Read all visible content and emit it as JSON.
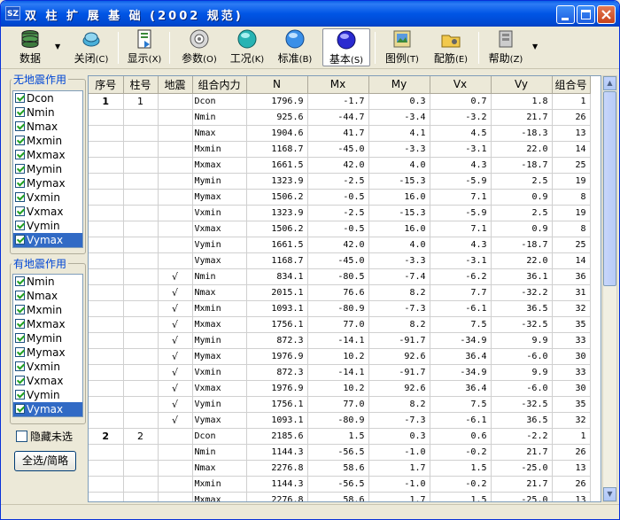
{
  "window": {
    "title": "双 柱 扩 展 基 础 (2002 规范)",
    "icon": "SZ"
  },
  "toolbar": [
    {
      "label": "数据",
      "key": "(D)",
      "icon": "database-icon",
      "dropdown": true
    },
    {
      "label": "关闭",
      "key": "(C)",
      "icon": "close-disk-icon"
    },
    {
      "label": "显示",
      "key": "(X)",
      "icon": "display-icon"
    },
    {
      "label": "参数",
      "key": "(O)",
      "icon": "params-icon"
    },
    {
      "label": "工况",
      "key": "(K)",
      "icon": "case-icon"
    },
    {
      "label": "标准",
      "key": "(B)",
      "icon": "standard-icon"
    },
    {
      "label": "基本",
      "key": "(S)",
      "icon": "basic-icon",
      "active": true
    },
    {
      "label": "图例",
      "key": "(T)",
      "icon": "legend-icon"
    },
    {
      "label": "配筋",
      "key": "(E)",
      "icon": "rebar-icon"
    },
    {
      "label": "帮助",
      "key": "(Z)",
      "icon": "help-icon",
      "dropdown": true
    }
  ],
  "left": {
    "group1": {
      "label": "无地震作用",
      "items": [
        "Dcon",
        "Nmin",
        "Nmax",
        "Mxmin",
        "Mxmax",
        "Mymin",
        "Mymax",
        "Vxmin",
        "Vxmax",
        "Vymin",
        "Vymax"
      ],
      "selected": "Vymax"
    },
    "group2": {
      "label": "有地震作用",
      "items": [
        "Nmin",
        "Nmax",
        "Mxmin",
        "Mxmax",
        "Mymin",
        "Mymax",
        "Vxmin",
        "Vxmax",
        "Vymin",
        "Vymax"
      ],
      "selected": "Vymax"
    },
    "hide_label": "隐藏未选",
    "select_all": "全选/简略"
  },
  "table": {
    "columns": [
      "序号",
      "柱号",
      "地震",
      "组合内力",
      "N",
      "Mx",
      "My",
      "Vx",
      "Vy",
      "组合号"
    ],
    "rows": [
      [
        "1",
        "1",
        "",
        "Dcon",
        "1796.9",
        "-1.7",
        "0.3",
        "0.7",
        "1.8",
        "1"
      ],
      [
        "",
        "",
        "",
        "Nmin",
        "925.6",
        "-44.7",
        "-3.4",
        "-3.2",
        "21.7",
        "26"
      ],
      [
        "",
        "",
        "",
        "Nmax",
        "1904.6",
        "41.7",
        "4.1",
        "4.5",
        "-18.3",
        "13"
      ],
      [
        "",
        "",
        "",
        "Mxmin",
        "1168.7",
        "-45.0",
        "-3.3",
        "-3.1",
        "22.0",
        "14"
      ],
      [
        "",
        "",
        "",
        "Mxmax",
        "1661.5",
        "42.0",
        "4.0",
        "4.3",
        "-18.7",
        "25"
      ],
      [
        "",
        "",
        "",
        "Mymin",
        "1323.9",
        "-2.5",
        "-15.3",
        "-5.9",
        "2.5",
        "19"
      ],
      [
        "",
        "",
        "",
        "Mymax",
        "1506.2",
        "-0.5",
        "16.0",
        "7.1",
        "0.9",
        "8"
      ],
      [
        "",
        "",
        "",
        "Vxmin",
        "1323.9",
        "-2.5",
        "-15.3",
        "-5.9",
        "2.5",
        "19"
      ],
      [
        "",
        "",
        "",
        "Vxmax",
        "1506.2",
        "-0.5",
        "16.0",
        "7.1",
        "0.9",
        "8"
      ],
      [
        "",
        "",
        "",
        "Vymin",
        "1661.5",
        "42.0",
        "4.0",
        "4.3",
        "-18.7",
        "25"
      ],
      [
        "",
        "",
        "",
        "Vymax",
        "1168.7",
        "-45.0",
        "-3.3",
        "-3.1",
        "22.0",
        "14"
      ],
      [
        "",
        "",
        "√",
        "Nmin",
        "834.1",
        "-80.5",
        "-7.4",
        "-6.2",
        "36.1",
        "36"
      ],
      [
        "",
        "",
        "√",
        "Nmax",
        "2015.1",
        "76.6",
        "8.2",
        "7.7",
        "-32.2",
        "31"
      ],
      [
        "",
        "",
        "√",
        "Mxmin",
        "1093.1",
        "-80.9",
        "-7.3",
        "-6.1",
        "36.5",
        "32"
      ],
      [
        "",
        "",
        "√",
        "Mxmax",
        "1756.1",
        "77.0",
        "8.2",
        "7.5",
        "-32.5",
        "35"
      ],
      [
        "",
        "",
        "√",
        "Mymin",
        "872.3",
        "-14.1",
        "-91.7",
        "-34.9",
        "9.9",
        "33"
      ],
      [
        "",
        "",
        "√",
        "Mymax",
        "1976.9",
        "10.2",
        "92.6",
        "36.4",
        "-6.0",
        "30"
      ],
      [
        "",
        "",
        "√",
        "Vxmin",
        "872.3",
        "-14.1",
        "-91.7",
        "-34.9",
        "9.9",
        "33"
      ],
      [
        "",
        "",
        "√",
        "Vxmax",
        "1976.9",
        "10.2",
        "92.6",
        "36.4",
        "-6.0",
        "30"
      ],
      [
        "",
        "",
        "√",
        "Vymin",
        "1756.1",
        "77.0",
        "8.2",
        "7.5",
        "-32.5",
        "35"
      ],
      [
        "",
        "",
        "√",
        "Vymax",
        "1093.1",
        "-80.9",
        "-7.3",
        "-6.1",
        "36.5",
        "32"
      ],
      [
        "2",
        "2",
        "",
        "Dcon",
        "2185.6",
        "1.5",
        "0.3",
        "0.6",
        "-2.2",
        "1"
      ],
      [
        "",
        "",
        "",
        "Nmin",
        "1144.3",
        "-56.5",
        "-1.0",
        "-0.2",
        "21.7",
        "26"
      ],
      [
        "",
        "",
        "",
        "Nmax",
        "2276.8",
        "58.6",
        "1.7",
        "1.5",
        "-25.0",
        "13"
      ],
      [
        "",
        "",
        "",
        "Mxmin",
        "1144.3",
        "-56.5",
        "-1.0",
        "-0.2",
        "21.7",
        "26"
      ],
      [
        "",
        "",
        "",
        "Mxmax",
        "2276.8",
        "58.6",
        "1.7",
        "1.5",
        "-25.0",
        "13"
      ]
    ]
  }
}
